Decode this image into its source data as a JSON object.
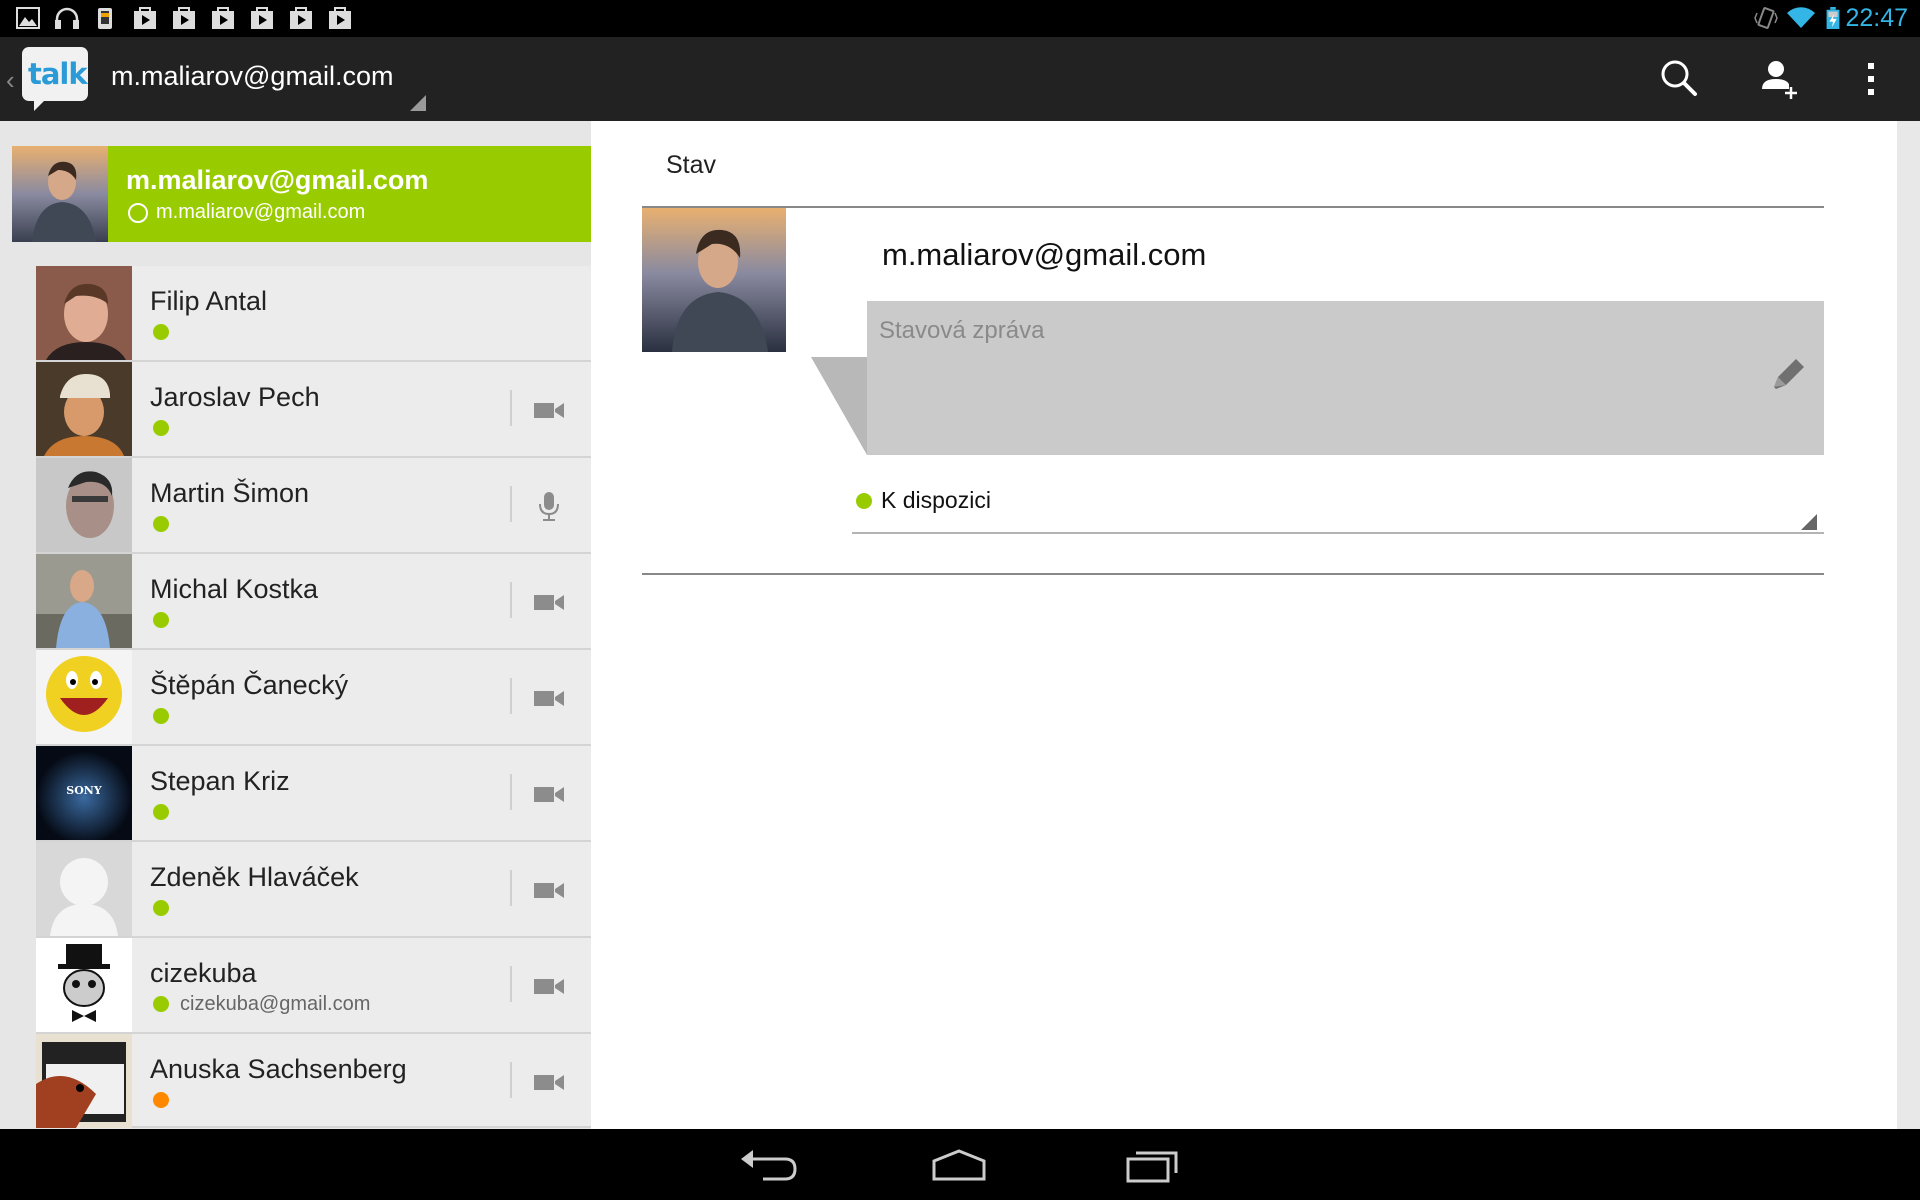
{
  "status_bar": {
    "time": "22:47",
    "left_icons": [
      "gallery-icon",
      "headphones-icon",
      "phone-download-icon",
      "play-store-icon",
      "play-store-icon",
      "play-store-icon",
      "play-store-icon",
      "play-store-icon",
      "play-store-icon"
    ],
    "right_icons": [
      "vibrate-icon",
      "wifi-icon",
      "battery-charging-icon"
    ],
    "accent_color": "#33b5e5"
  },
  "action_bar": {
    "logo_text": "talk",
    "account": "m.maliarov@gmail.com",
    "actions": [
      "search-icon",
      "add-contact-icon",
      "overflow-menu-icon"
    ]
  },
  "self_card": {
    "name": "m.maliarov@gmail.com",
    "status_text": "m.maliarov@gmail.com",
    "color": "#99cc00"
  },
  "contacts": [
    {
      "name": "Filip Antal",
      "status": "available",
      "sub": "",
      "action": ""
    },
    {
      "name": "Jaroslav Pech",
      "status": "available",
      "sub": "",
      "action": "video-icon"
    },
    {
      "name": "Martin Šimon",
      "status": "available",
      "sub": "",
      "action": "microphone-icon"
    },
    {
      "name": "Michal Kostka",
      "status": "available",
      "sub": "",
      "action": "video-icon"
    },
    {
      "name": "Štěpán Čanecký",
      "status": "available",
      "sub": "",
      "action": "video-icon"
    },
    {
      "name": "Stepan Kriz",
      "status": "available",
      "sub": "",
      "action": "video-icon"
    },
    {
      "name": "Zdeněk Hlaváček",
      "status": "available",
      "sub": "",
      "action": "video-icon"
    },
    {
      "name": "cizekuba",
      "status": "available",
      "sub": "cizekuba@gmail.com",
      "action": "video-icon"
    },
    {
      "name": "Anuska Sachsenberg",
      "status": "away",
      "sub": "",
      "action": "video-icon"
    }
  ],
  "detail": {
    "section_title": "Stav",
    "name": "m.maliarov@gmail.com",
    "status_message_placeholder": "Stavová zpráva",
    "availability": "K dispozici"
  },
  "nav_bar": [
    "back-icon",
    "home-icon",
    "recent-apps-icon"
  ]
}
